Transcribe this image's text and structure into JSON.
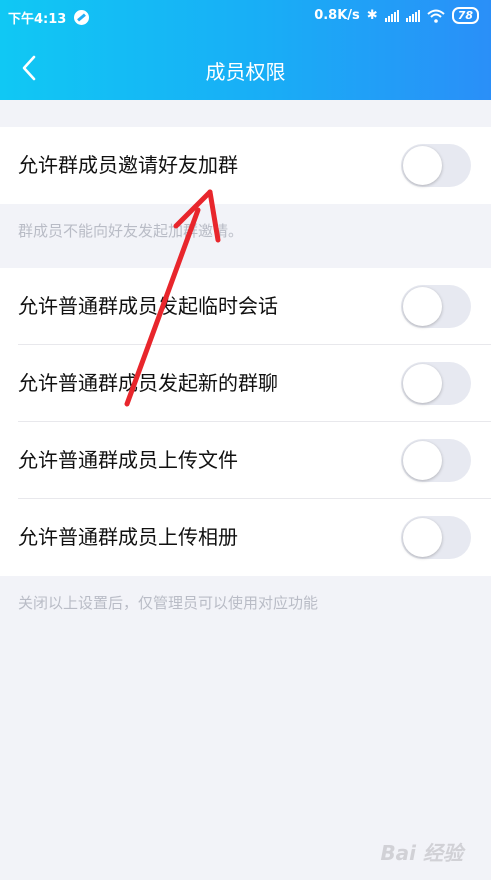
{
  "status_bar": {
    "time": "下午4:13",
    "network_speed": "0.8K/s",
    "battery": "78"
  },
  "nav": {
    "title": "成员权限"
  },
  "settings": {
    "invite": {
      "label": "允许群成员邀请好友加群",
      "enabled": false,
      "hint": "群成员不能向好友发起加群邀请。"
    },
    "items": [
      {
        "label": "允许普通群成员发起临时会话",
        "enabled": false
      },
      {
        "label": "允许普通群成员发起新的群聊",
        "enabled": false
      },
      {
        "label": "允许普通群成员上传文件",
        "enabled": false
      },
      {
        "label": "允许普通群成员上传相册",
        "enabled": false
      }
    ],
    "footer_hint": "关闭以上设置后，仅管理员可以使用对应功能"
  },
  "watermark": "Bai 经验",
  "colors": {
    "header_start": "#10c8f4",
    "header_end": "#2a8ff8",
    "annotation_arrow": "#e8262c",
    "toggle_off": "#e7e9f1"
  }
}
